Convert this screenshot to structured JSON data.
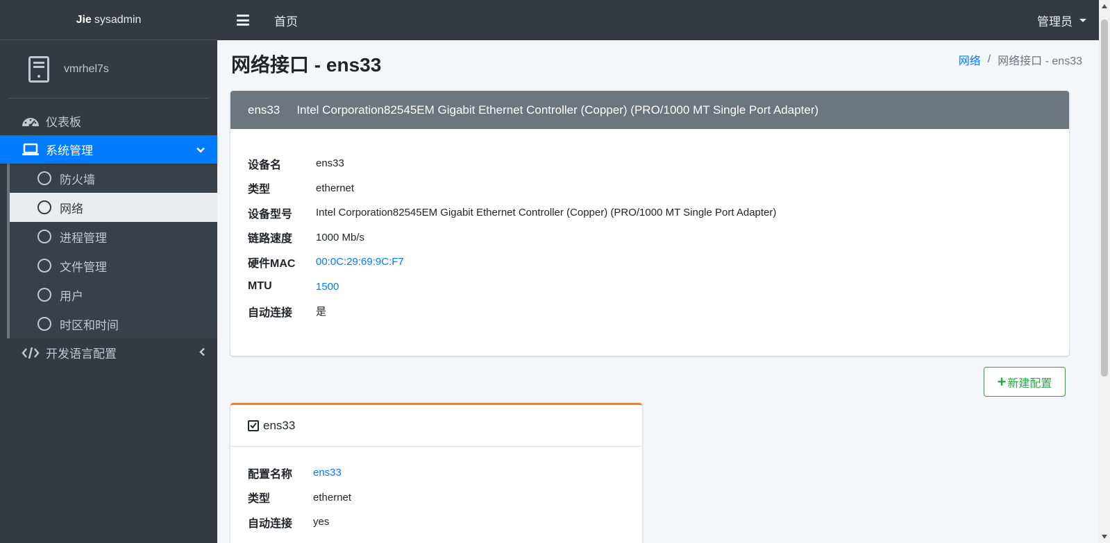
{
  "brand": {
    "bold": "Jie",
    "light": "sysadmin"
  },
  "user_panel": {
    "name": "vmrhel7s",
    "icon": "server-icon"
  },
  "sidebar": {
    "items": [
      {
        "label": "仪表板",
        "icon": "dashboard-icon"
      },
      {
        "label": "系统管理",
        "icon": "laptop-icon",
        "active": true
      },
      {
        "label": "开发语言配置",
        "icon": "code-icon"
      }
    ],
    "sub_items": [
      {
        "label": "防火墙"
      },
      {
        "label": "网络",
        "active": true
      },
      {
        "label": "进程管理"
      },
      {
        "label": "文件管理"
      },
      {
        "label": "用户"
      },
      {
        "label": "时区和时间"
      }
    ]
  },
  "header": {
    "home": "首页",
    "admin": "管理员"
  },
  "page": {
    "title_prefix": "网络接口 - ",
    "title_bold": "ens33",
    "breadcrumb": {
      "link": "网络",
      "current": "网络接口 - ens33"
    }
  },
  "interface_card": {
    "header_device": "ens33",
    "header_model": "Intel Corporation82545EM Gigabit Ethernet Controller (Copper) (PRO/1000 MT Single Port Adapter)",
    "rows": [
      {
        "label": "设备名",
        "value": "ens33"
      },
      {
        "label": "类型",
        "value": "ethernet"
      },
      {
        "label": "设备型号",
        "value": "Intel Corporation82545EM Gigabit Ethernet Controller (Copper) (PRO/1000 MT Single Port Adapter)"
      },
      {
        "label": "链路速度",
        "value": "1000 Mb/s"
      },
      {
        "label": "硬件MAC",
        "value": "00:0C:29:69:9C:F7"
      },
      {
        "label": "MTU",
        "value": "1500"
      },
      {
        "label": "自动连接",
        "value": "是"
      }
    ]
  },
  "new_config_button": "新建配置",
  "config_card": {
    "title": "ens33",
    "rows": [
      {
        "label": "配置名称",
        "value": "ens33"
      },
      {
        "label": "类型",
        "value": "ethernet"
      },
      {
        "label": "自动连接",
        "value": "yes"
      }
    ]
  },
  "colors": {
    "sidebar_bg": "#343a40",
    "primary": "#007bff",
    "success": "#28a745",
    "warning": "#fd7e14",
    "card_header": "#6c757d"
  }
}
